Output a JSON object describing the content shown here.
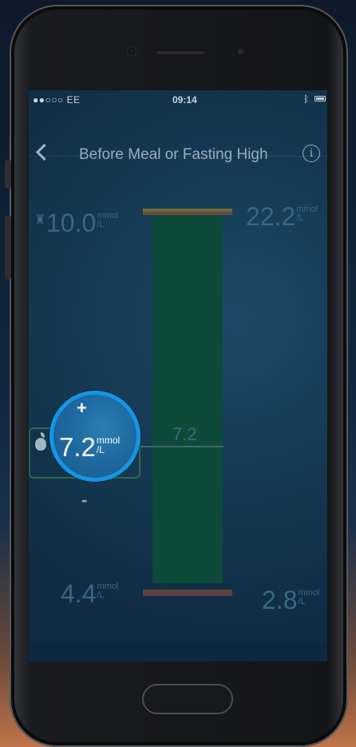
{
  "status_bar": {
    "carrier": "●●○○○ EE",
    "time": "09:14"
  },
  "nav": {
    "title": "Before Meal or Fasting High",
    "info_glyph": "i"
  },
  "readings": {
    "upper_left": {
      "value": "10.0",
      "unit_top": "mmol",
      "unit_bottom": "/L"
    },
    "upper_right": {
      "value": "22.2",
      "unit_top": "mmol",
      "unit_bottom": "/L"
    },
    "lower_left": {
      "value": "4.4",
      "unit_top": "mmol",
      "unit_bottom": "/L"
    },
    "lower_right": {
      "value": "2.8",
      "unit_top": "mmol",
      "unit_bottom": "/L"
    }
  },
  "bar": {
    "mid_label": "7.2"
  },
  "selector": {
    "plus": "+",
    "minus": "-",
    "value": "7.2",
    "unit_top": "mmol",
    "unit_bottom": "/L"
  },
  "colors": {
    "accent": "#1396e6",
    "bar": "#0d4a3a",
    "screen_bg": "#163b55"
  }
}
